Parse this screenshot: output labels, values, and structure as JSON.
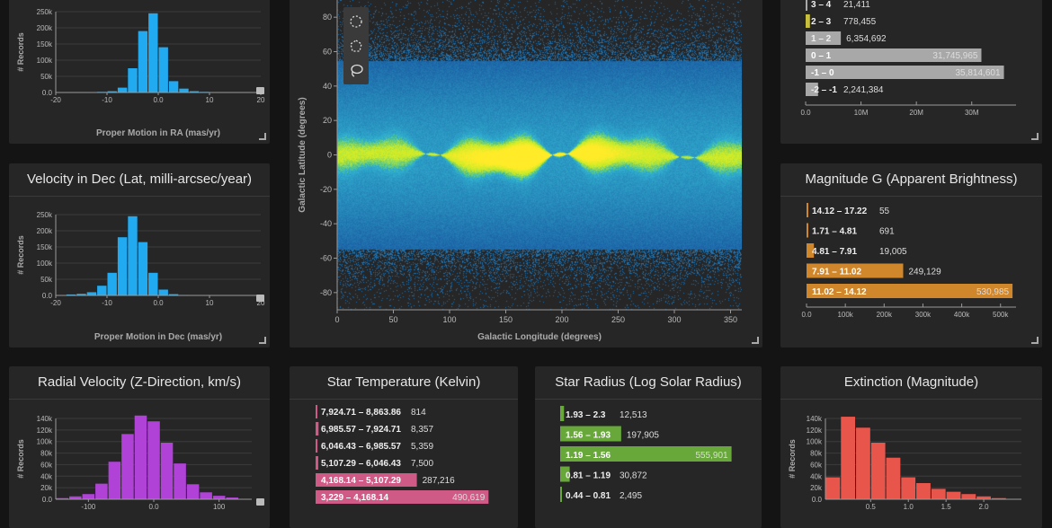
{
  "colors": {
    "ra": "#22aaf0",
    "dec": "#22aaf0",
    "rv": "#b042d8",
    "temp": "#d05a86",
    "radius": "#68a83a",
    "ext": "#e8554b",
    "mag": "#d0862a",
    "bp": "#a8a8a8",
    "bp_sel": "#c8bf3c",
    "gray": "#bdbdbd"
  },
  "ra": {
    "title": "",
    "xlabel": "Proper Motion in RA (mas/yr)",
    "ylabel": "# Records"
  },
  "dec": {
    "title": "Velocity in Dec (Lat, milli-arcsec/year)",
    "xlabel": "Proper Motion in Dec (mas/yr)",
    "ylabel": "# Records"
  },
  "rv": {
    "title": "Radial Velocity (Z-Direction, km/s)",
    "ylabel": "# Records"
  },
  "temp": {
    "title": "Star Temperature (Kelvin)"
  },
  "radius": {
    "title": "Star Radius (Log Solar Radius)"
  },
  "ext": {
    "title": "Extinction (Magnitude)",
    "ylabel": "# Records"
  },
  "mag": {
    "title": "Magnitude G (Apparent Brightness)"
  },
  "sky": {
    "xlabel": "Galactic Longitude (degrees)",
    "ylabel": "Galactic Latitude (degrees)"
  },
  "chart_data": [
    {
      "id": "ra",
      "type": "bar",
      "xlim": [
        -20,
        20
      ],
      "ylim": [
        0,
        250000
      ],
      "xticks": [
        "-20",
        "-10",
        "0.0",
        "10",
        "20"
      ],
      "yticks": [
        "0.0",
        "50k",
        "100k",
        "150k",
        "200k",
        "250k"
      ],
      "bin_starts": [
        -12,
        -10,
        -8,
        -6,
        -4,
        -2,
        0,
        2,
        4,
        6,
        8,
        10,
        12,
        14
      ],
      "values": [
        2000,
        4000,
        15000,
        75000,
        190000,
        245000,
        140000,
        35000,
        12000,
        4000,
        2000,
        1000,
        500,
        300
      ]
    },
    {
      "id": "dec",
      "type": "bar",
      "xlim": [
        -20,
        20
      ],
      "ylim": [
        0,
        250000
      ],
      "xticks": [
        "-20",
        "-10",
        "0.0",
        "10",
        "20"
      ],
      "yticks": [
        "0.0",
        "50k",
        "100k",
        "150k",
        "200k",
        "250k"
      ],
      "bin_starts": [
        -18,
        -16,
        -14,
        -12,
        -10,
        -8,
        -6,
        -4,
        -2,
        0,
        2,
        4,
        6,
        8
      ],
      "values": [
        3000,
        5000,
        10000,
        30000,
        70000,
        180000,
        245000,
        165000,
        70000,
        18000,
        4000,
        1500,
        700,
        300
      ]
    },
    {
      "id": "rv",
      "type": "bar",
      "xlim": [
        -150,
        150
      ],
      "ylim": [
        0,
        140000
      ],
      "xticks": [
        "-100",
        "0.0",
        "100"
      ],
      "yticks": [
        "0.0",
        "20k",
        "40k",
        "60k",
        "80k",
        "100k",
        "120k",
        "140k"
      ],
      "bin_starts": [
        -150,
        -130,
        -110,
        -90,
        -70,
        -50,
        -30,
        -10,
        10,
        30,
        50,
        70,
        90,
        110
      ],
      "values": [
        2000,
        5000,
        9000,
        27000,
        65000,
        113000,
        145000,
        135000,
        98000,
        62000,
        26000,
        12000,
        6000,
        3000
      ]
    },
    {
      "id": "ext",
      "type": "bar",
      "xlim": [
        -0.1,
        2.5
      ],
      "ylim": [
        0,
        140000
      ],
      "xticks": [
        "0.5",
        "1.0",
        "1.5",
        "2.0"
      ],
      "yticks": [
        "0.0",
        "20k",
        "40k",
        "60k",
        "80k",
        "100k",
        "120k",
        "140k"
      ],
      "bin_starts": [
        -0.1,
        0.1,
        0.3,
        0.5,
        0.7,
        0.9,
        1.1,
        1.3,
        1.5,
        1.7,
        1.9,
        2.1
      ],
      "values": [
        38000,
        143000,
        124000,
        98000,
        72000,
        38000,
        28000,
        18000,
        13000,
        9000,
        5000,
        2000
      ]
    },
    {
      "id": "bp",
      "type": "bar",
      "orientation": "horizontal",
      "xlim": [
        0,
        38000000
      ],
      "xticks": [
        "0.0",
        "10M",
        "20M",
        "30M"
      ],
      "categories": [
        "3 – 4",
        "2 – 3",
        "1 – 2",
        "0 – 1",
        "-1 – 0",
        "-2 – -1"
      ],
      "values": [
        21411,
        778455,
        6354692,
        31745965,
        35814601,
        2241384
      ],
      "labels": [
        "21,411",
        "778,455",
        "6,354,692",
        "31,745,965",
        "35,814,601",
        "2,241,384"
      ]
    },
    {
      "id": "mag",
      "type": "bar",
      "orientation": "horizontal",
      "xlim": [
        0,
        540000
      ],
      "xticks": [
        "0.0",
        "100k",
        "200k",
        "300k",
        "400k",
        "500k"
      ],
      "categories": [
        "14.12 – 17.22",
        "1.71 – 4.81",
        "4.81 – 7.91",
        "7.91 – 11.02",
        "11.02 – 14.12"
      ],
      "values": [
        55,
        691,
        19005,
        249129,
        530985
      ],
      "labels": [
        "55",
        "691",
        "19,005",
        "249,129",
        "530,985"
      ]
    },
    {
      "id": "temp",
      "type": "bar",
      "orientation": "horizontal",
      "xlim": [
        0,
        500000
      ],
      "categories": [
        "7,924.71 – 8,863.86",
        "6,985.57 – 7,924.71",
        "6,046.43 – 6,985.57",
        "5,107.29 – 6,046.43",
        "4,168.14 – 5,107.29",
        "3,229 – 4,168.14"
      ],
      "values": [
        814,
        8357,
        5359,
        7500,
        287216,
        490619
      ],
      "labels": [
        "814",
        "8,357",
        "5,359",
        "7,500",
        "287,216",
        "490,619"
      ]
    },
    {
      "id": "radius",
      "type": "bar",
      "orientation": "horizontal",
      "xlim": [
        0,
        560000
      ],
      "categories": [
        "1.93 – 2.3",
        "1.56 – 1.93",
        "1.19 – 1.56",
        "0.81 – 1.19",
        "0.44 – 0.81"
      ],
      "values": [
        12513,
        197905,
        555901,
        30872,
        2495
      ],
      "labels": [
        "12,513",
        "197,905",
        "555,901",
        "30,872",
        "2,495"
      ]
    },
    {
      "id": "sky",
      "type": "scatter",
      "xlim": [
        0,
        360
      ],
      "ylim": [
        -90,
        90
      ],
      "xticks": [
        "0",
        "50",
        "100",
        "150",
        "200",
        "250",
        "300",
        "350"
      ],
      "yticks": [
        "-80",
        "-60",
        "-40",
        "-20",
        "0",
        "20",
        "40",
        "60",
        "80"
      ]
    }
  ]
}
